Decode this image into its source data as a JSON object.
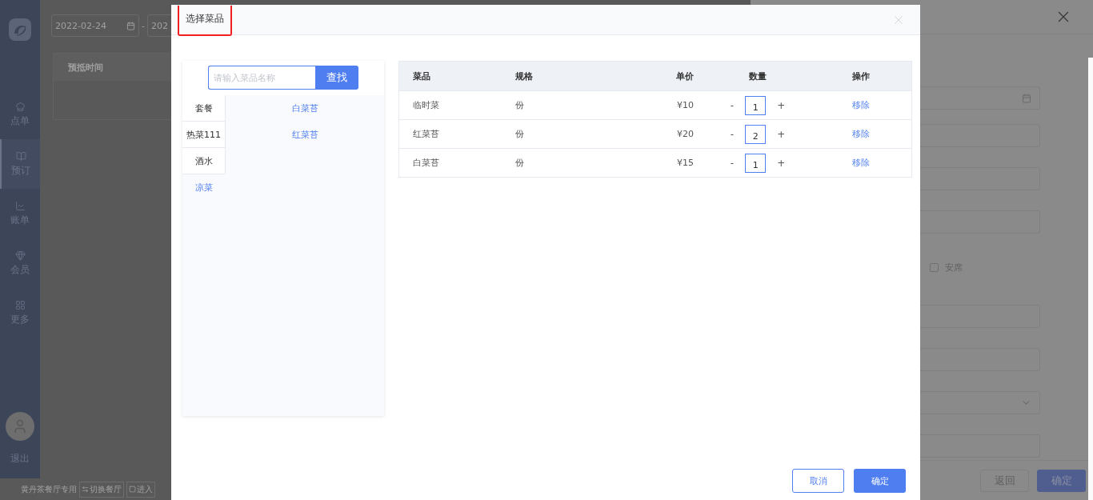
{
  "sidebar": {
    "items": [
      {
        "label": "点单",
        "selected": false
      },
      {
        "label": "预订",
        "selected": true
      },
      {
        "label": "账单",
        "selected": false
      },
      {
        "label": "会员",
        "selected": false
      },
      {
        "label": "更多",
        "selected": false
      }
    ],
    "logout": "退出"
  },
  "toolbar": {
    "date_start": "2022-02-24",
    "separator": "-",
    "date_end": "202"
  },
  "background_table": {
    "columns": [
      "预抵时间"
    ]
  },
  "status_bar": {
    "restaurant": "黄丹茶餐厅专用",
    "buttons": [
      {
        "label": "切换餐厅"
      },
      {
        "label": "进入"
      }
    ]
  },
  "drawer": {
    "fields": [
      {
        "kind": "date"
      },
      {
        "kind": "input"
      },
      {
        "kind": "input"
      },
      {
        "kind": "input"
      },
      {
        "kind": "checkbox",
        "label": "安席",
        "checked": false
      },
      {
        "kind": "input"
      },
      {
        "kind": "input"
      },
      {
        "kind": "select"
      },
      {
        "kind": "input"
      }
    ],
    "buttons": [
      {
        "label": "返回",
        "kind": "secondary"
      },
      {
        "label": "确定",
        "kind": "primary"
      }
    ]
  },
  "dialog": {
    "title": "选择菜品",
    "search": {
      "placeholder": "请输入菜品名称",
      "button": "查找"
    },
    "categories": [
      {
        "label": "套餐",
        "selected": false
      },
      {
        "label": "热菜111",
        "selected": false
      },
      {
        "label": "酒水",
        "selected": false
      },
      {
        "label": "凉菜",
        "selected": true
      }
    ],
    "dishes": [
      "白菜苔",
      "红菜苔"
    ],
    "table": {
      "columns": [
        "菜品",
        "规格",
        "单价",
        "数量",
        "操作"
      ],
      "rows": [
        {
          "dish": "临时菜",
          "unit": "份",
          "price": "¥10",
          "minus": "-",
          "quantity": "1",
          "plus": "+",
          "action": "移除"
        },
        {
          "dish": "红菜苔",
          "unit": "份",
          "price": "¥20",
          "minus": "-",
          "quantity": "2",
          "plus": "+",
          "action": "移除"
        },
        {
          "dish": "白菜苔",
          "unit": "份",
          "price": "¥15",
          "minus": "-",
          "quantity": "1",
          "plus": "+",
          "action": "移除"
        }
      ]
    },
    "buttons": [
      {
        "label": "取消",
        "kind": "secondary"
      },
      {
        "label": "确定",
        "kind": "primary"
      }
    ]
  }
}
